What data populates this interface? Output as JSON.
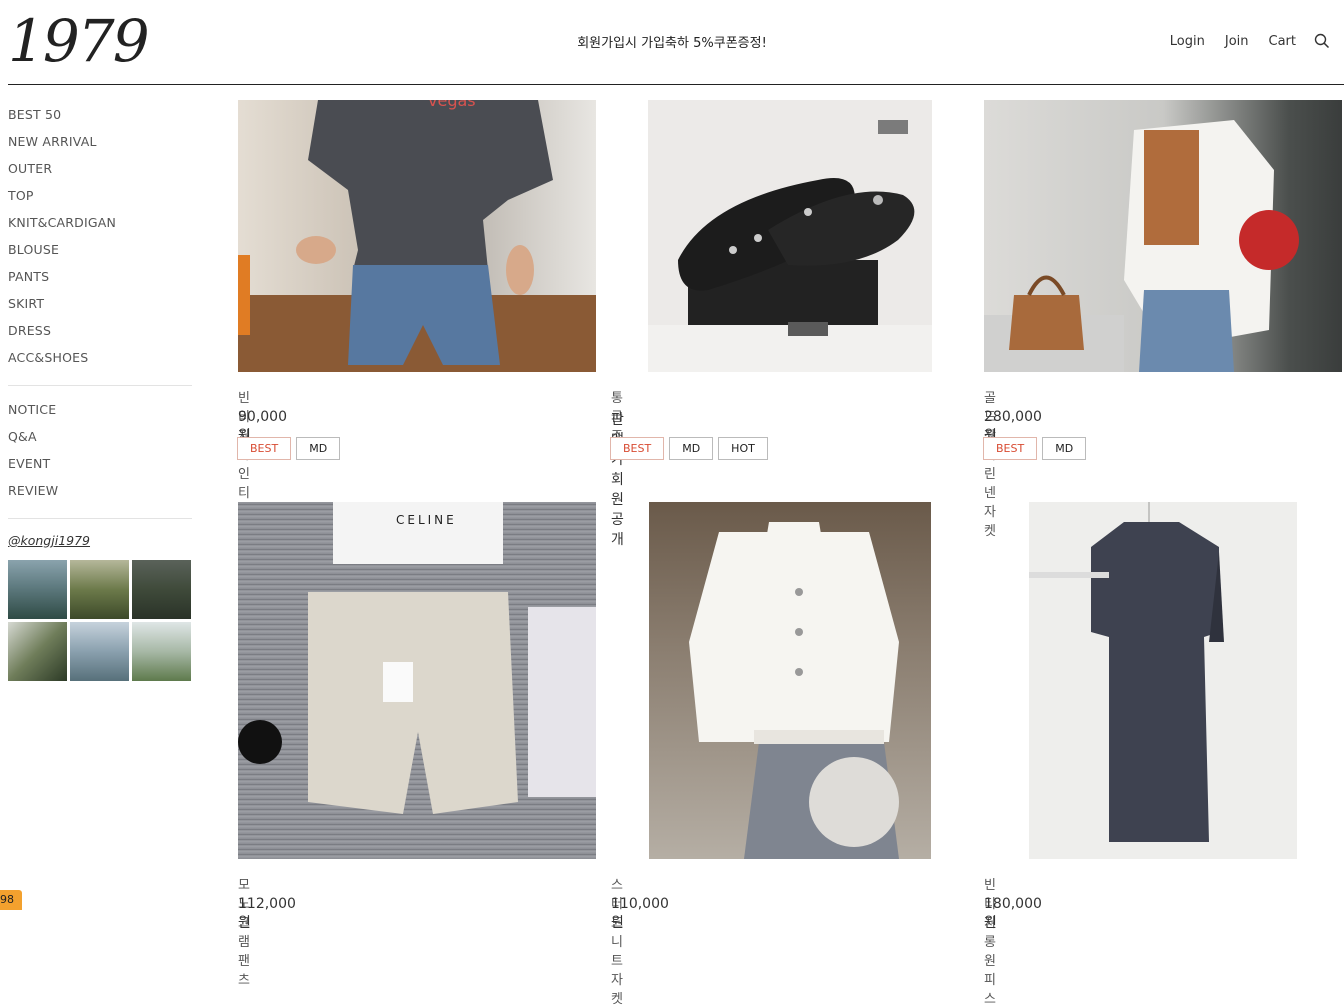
{
  "header": {
    "logo": "1979",
    "promo": "회원가입시 가입축하 5%쿠폰증정!",
    "nav": {
      "login": "Login",
      "join": "Join",
      "cart": "Cart"
    }
  },
  "sidebar": {
    "categories": [
      "BEST 50",
      "NEW ARRIVAL",
      "OUTER",
      "TOP",
      "KNIT&CARDIGAN",
      "BLOUSE",
      "PANTS",
      "SKIRT",
      "DRESS",
      "ACC&SHOES"
    ],
    "community": [
      "NOTICE",
      "Q&A",
      "EVENT",
      "REVIEW"
    ],
    "instagram_handle": "@kongji1979"
  },
  "products": [
    {
      "name": "빈티지 라인 티셔츠",
      "price": "90,000원",
      "badges": [
        "BEST",
        "MD"
      ]
    },
    {
      "name": "통굽 조리",
      "price": "판매가 회원공개",
      "badges": [
        "BEST",
        "MD",
        "HOT"
      ]
    },
    {
      "name": "골드 장식 린넨자켓",
      "price": "280,000원",
      "badges": [
        "BEST",
        "MD"
      ]
    },
    {
      "name": "모노그램 팬츠",
      "price": "112,000원",
      "badges": []
    },
    {
      "name": "스터드 니트 자켓",
      "price": "110,000원",
      "badges": []
    },
    {
      "name": "빈티지 롱 원피스",
      "price": "180,000원",
      "badges": []
    }
  ],
  "corner_tab": "98",
  "colors": {
    "best_badge": "#d84c33",
    "header_line": "#222222",
    "corner_tab": "#f3a12e"
  }
}
